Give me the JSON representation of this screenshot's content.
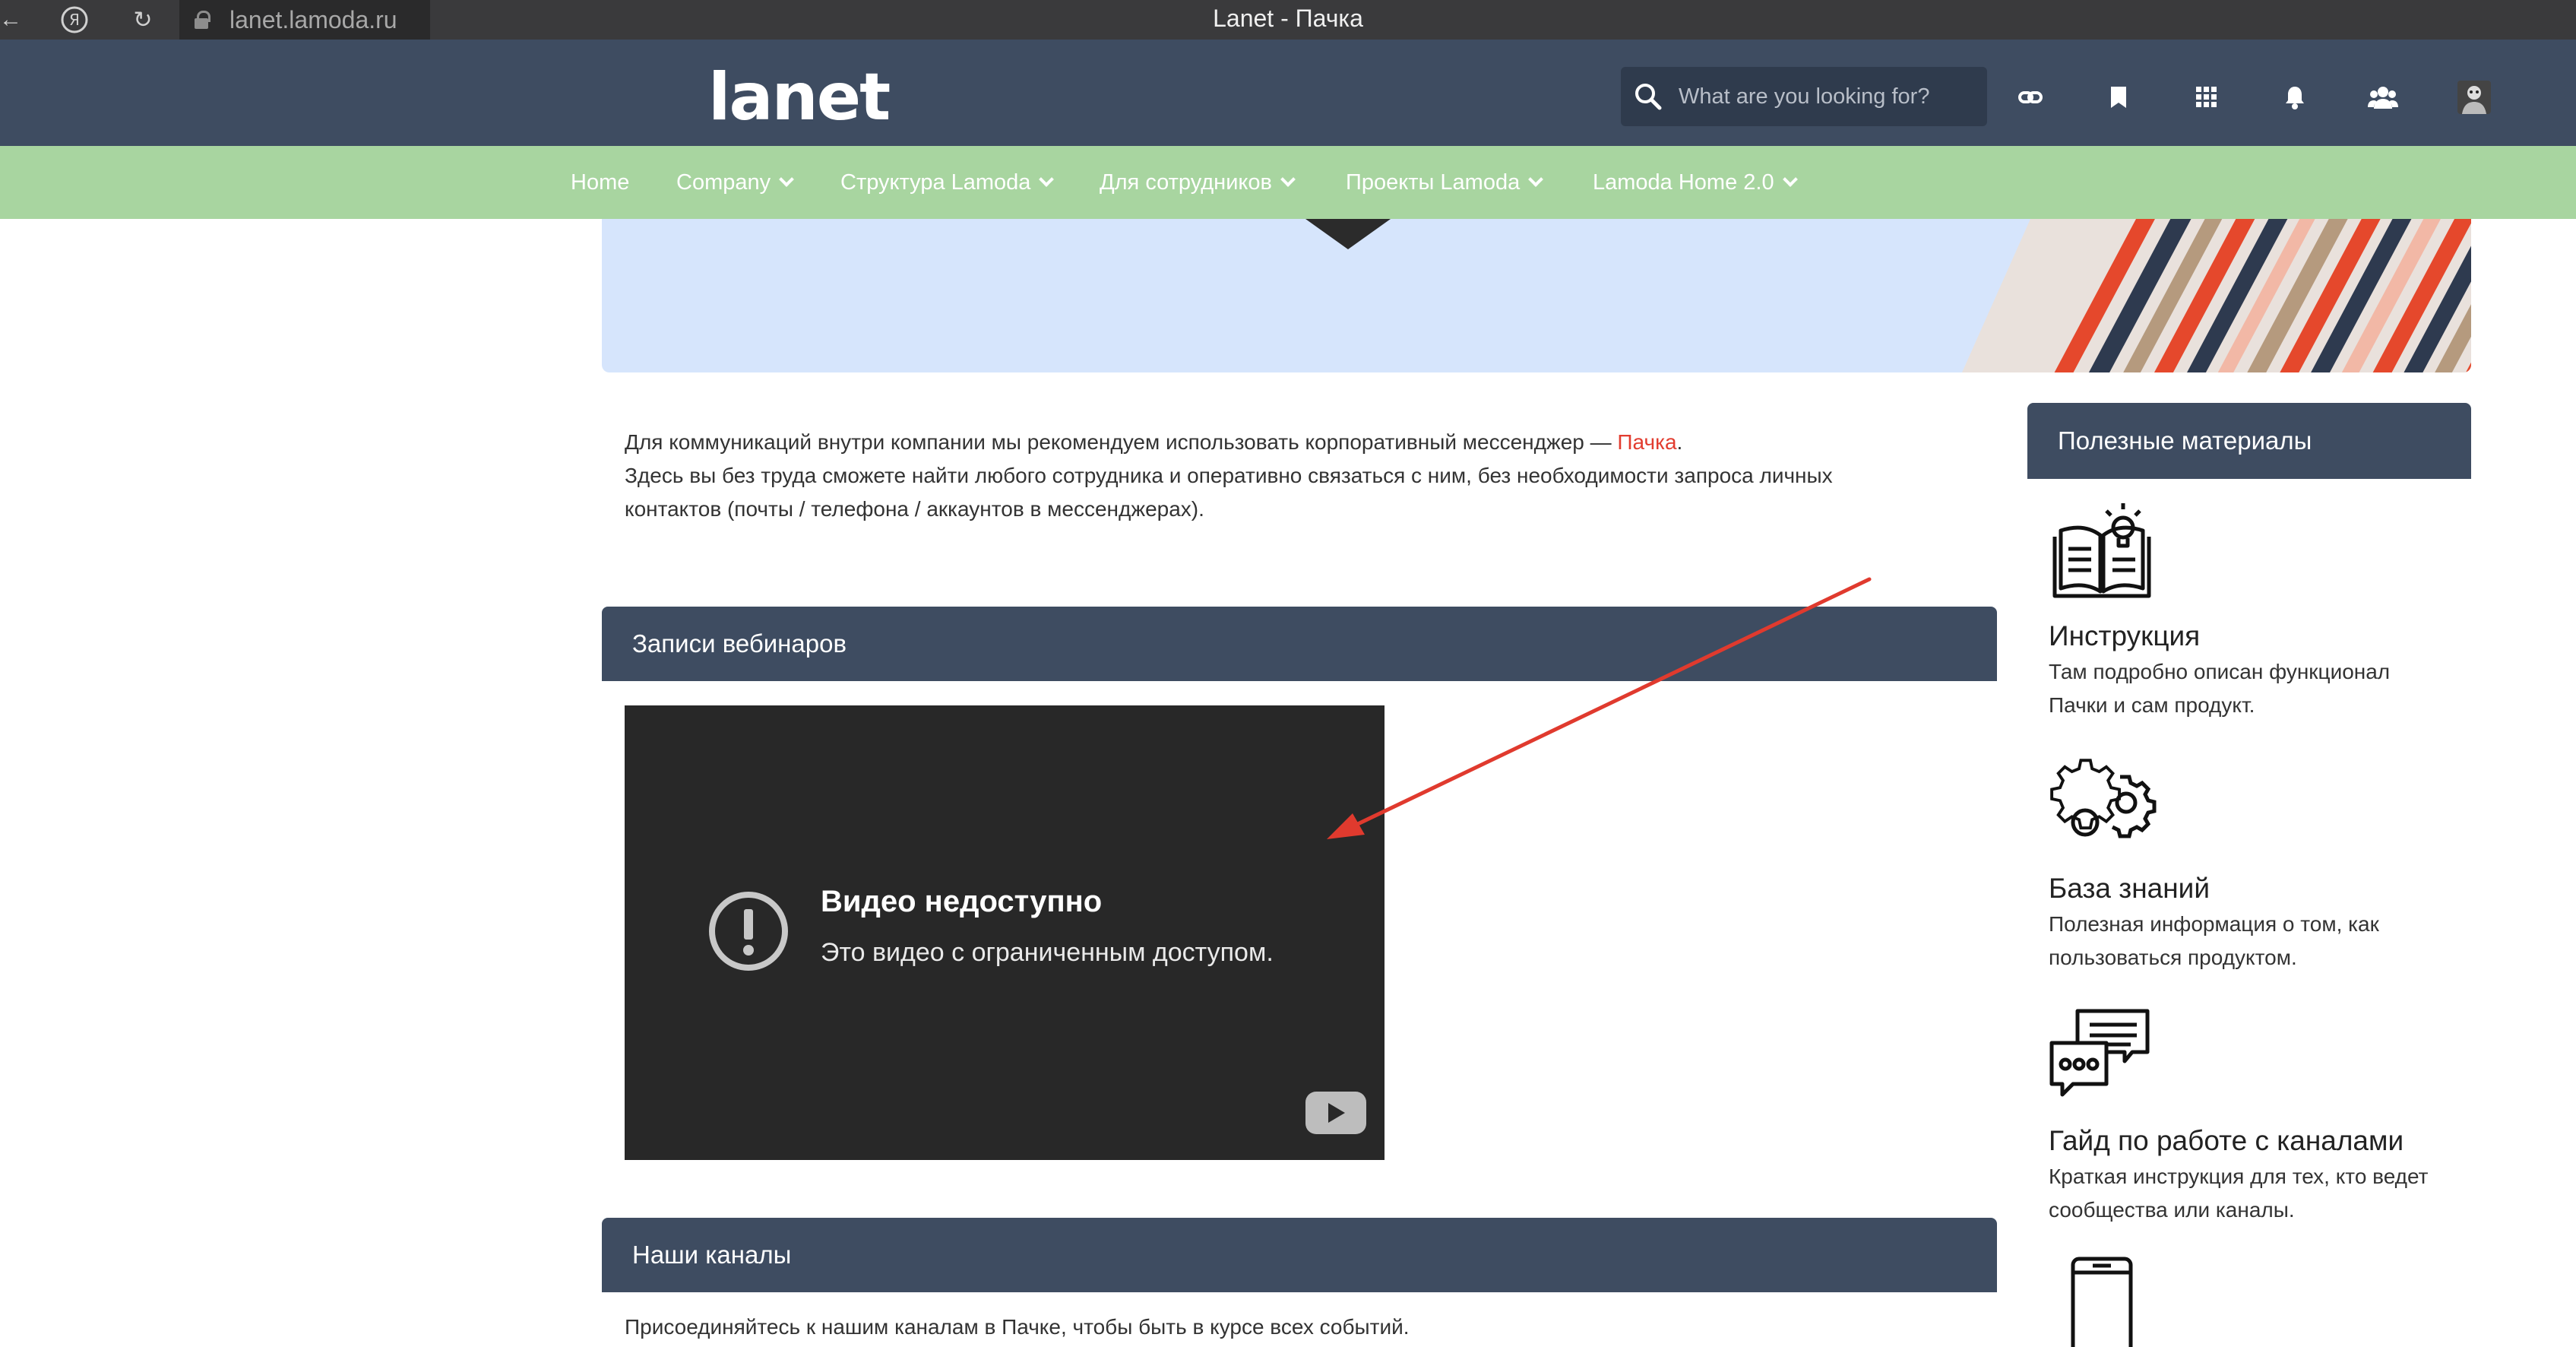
{
  "browser": {
    "url": "lanet.lamoda.ru",
    "window_title": "Lanet - Пачка"
  },
  "header": {
    "logo": "lanet",
    "search_placeholder": "What are you looking for?"
  },
  "nav": {
    "items": [
      {
        "label": "Home",
        "dropdown": false
      },
      {
        "label": "Company",
        "dropdown": true
      },
      {
        "label": "Структура Lamoda",
        "dropdown": true
      },
      {
        "label": "Для сотрудников",
        "dropdown": true
      },
      {
        "label": "Проекты Lamoda",
        "dropdown": true
      },
      {
        "label": "Lamoda Home 2.0",
        "dropdown": true
      }
    ]
  },
  "intro": {
    "line1_before": "Для коммуникаций внутри компании мы рекомендуем использовать корпоративный мессенджер — ",
    "line1_link": "Пачка",
    "line1_after": ".",
    "line2": "Здесь вы без труда сможете найти любого сотрудника и оперативно связаться с ним, без необходимости запроса личных",
    "line3": "контактов (почты / телефона / аккаунтов в мессенджерах)."
  },
  "webinars": {
    "title": "Записи вебинаров",
    "video": {
      "title": "Видео недоступно",
      "subtitle": "Это видео с ограниченным доступом."
    }
  },
  "channels": {
    "title": "Наши каналы",
    "text": "Присоединяйтесь к нашим каналам в Пачке, чтобы быть в курсе всех событий."
  },
  "sidebar": {
    "title": "Полезные материалы",
    "items": [
      {
        "icon": "book-lightbulb-icon",
        "title": "Инструкция",
        "desc1": "Там подробно описан функционал",
        "desc2": "Пачки и сам продукт."
      },
      {
        "icon": "gears-icon",
        "title": "База знаний",
        "desc1": "Полезная информация о том, как",
        "desc2": "пользоваться продуктом."
      },
      {
        "icon": "chat-bubbles-icon",
        "title": "Гайд по работе с каналами",
        "desc1": "Краткая инструкция для тех, кто ведет",
        "desc2": "сообщества или каналы."
      },
      {
        "icon": "smartphone-icon"
      }
    ]
  },
  "colors": {
    "header_bg": "#3e4c61",
    "nav_bg": "#a8d5a0",
    "banner_bg": "#d6e5fc",
    "link": "#e23c2f",
    "annotation_arrow": "#e03a2e"
  }
}
